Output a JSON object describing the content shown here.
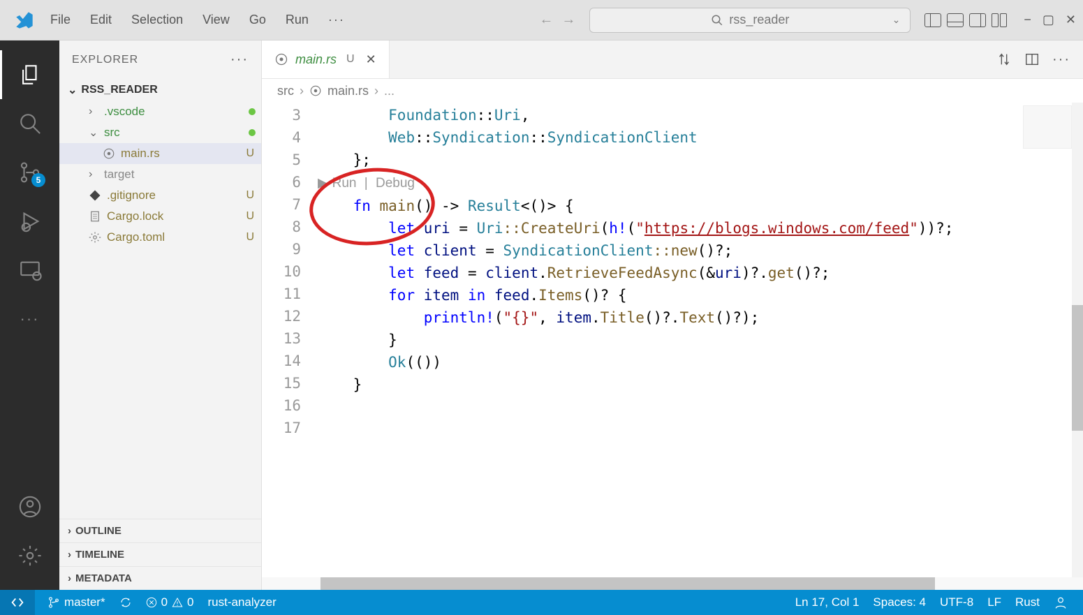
{
  "titlebar": {
    "menus": [
      "File",
      "Edit",
      "Selection",
      "View",
      "Go",
      "Run"
    ],
    "search_placeholder": "rss_reader"
  },
  "activitybar": {
    "scm_badge": "5"
  },
  "sidebar": {
    "title": "EXPLORER",
    "project": "RSS_READER",
    "tree": [
      {
        "label": ".vscode",
        "chevron": "›",
        "color": "green",
        "status": "dot",
        "indent": 1
      },
      {
        "label": "src",
        "chevron": "⌄",
        "color": "green",
        "status": "dot",
        "indent": 1
      },
      {
        "label": "main.rs",
        "icon": "rust",
        "color": "olive",
        "status": "U",
        "indent": 2,
        "selected": true
      },
      {
        "label": "target",
        "chevron": "›",
        "color": "grey",
        "indent": 1
      },
      {
        "label": ".gitignore",
        "icon": "git",
        "color": "olive",
        "status": "U",
        "indent": 1
      },
      {
        "label": "Cargo.lock",
        "icon": "file",
        "color": "olive",
        "status": "U",
        "indent": 1
      },
      {
        "label": "Cargo.toml",
        "icon": "gear",
        "color": "olive",
        "status": "U",
        "indent": 1
      }
    ],
    "collapsibles": [
      "OUTLINE",
      "TIMELINE",
      "METADATA"
    ]
  },
  "editor": {
    "tab": {
      "label": "main.rs",
      "status": "U"
    },
    "breadcrumb": [
      "src",
      "main.rs",
      "..."
    ],
    "codelens": {
      "run": "Run",
      "debug": "Debug"
    },
    "gutter": [
      "3",
      "4",
      "5",
      "6",
      "",
      "7",
      "8",
      "9",
      "10",
      "11",
      "12",
      "13",
      "14",
      "15",
      "16",
      "17"
    ],
    "code": {
      "l3_indent": "        ",
      "l3_a": "Foundation",
      "l3_b": "::",
      "l3_c": "Uri",
      "l3_d": ",",
      "l4_a": "Web",
      "l4_b": "::",
      "l4_c": "Syndication",
      "l4_d": "::",
      "l4_e": "SyndicationClient",
      "l5": "};",
      "l7_fn": "fn ",
      "l7_name": "main",
      "l7_paren": "() -> ",
      "l7_res": "Result",
      "l7_gen": "<()> {",
      "l8_let": "let ",
      "l8_var": "uri",
      "l8_eq": " = ",
      "l8_ty": "Uri",
      "l8_m": "::CreateUri",
      "l8_p1": "(",
      "l8_h": "h!",
      "l8_p2": "(",
      "l8_q1": "\"",
      "l8_url": "https://blogs.windows.com/feed",
      "l8_q2": "\"",
      "l8_p3": "))?;",
      "l9_let": "let ",
      "l9_var": "client",
      "l9_eq": " = ",
      "l9_ty": "SyndicationClient",
      "l9_m": "::new",
      "l9_p": "()?;",
      "l10_let": "let ",
      "l10_var": "feed",
      "l10_eq": " = ",
      "l10_cl": "client",
      "l10_dot": ".",
      "l10_m": "RetrieveFeedAsync",
      "l10_p1": "(&",
      "l10_uri": "uri",
      "l10_p2": ")?.",
      "l10_get": "get",
      "l10_p3": "()?;",
      "l12_for": "for ",
      "l12_item": "item",
      "l12_in": " in ",
      "l12_feed": "feed",
      "l12_dot": ".",
      "l12_m": "Items",
      "l12_p": "()? {",
      "l13_pr": "println!",
      "l13_p1": "(",
      "l13_f": "\"{}\"",
      "l13_c": ", ",
      "l13_item": "item",
      "l13_d1": ".",
      "l13_t": "Title",
      "l13_p2": "()?.",
      "l13_tx": "Text",
      "l13_p3": "()?);",
      "l14": "}",
      "l15_ok": "Ok",
      "l15_p": "(())",
      "l16": "}"
    }
  },
  "statusbar": {
    "branch": "master*",
    "errors": "0",
    "warnings": "0",
    "analyzer": "rust-analyzer",
    "pos": "Ln 17, Col 1",
    "spaces": "Spaces: 4",
    "encoding": "UTF-8",
    "eol": "LF",
    "lang": "Rust"
  }
}
